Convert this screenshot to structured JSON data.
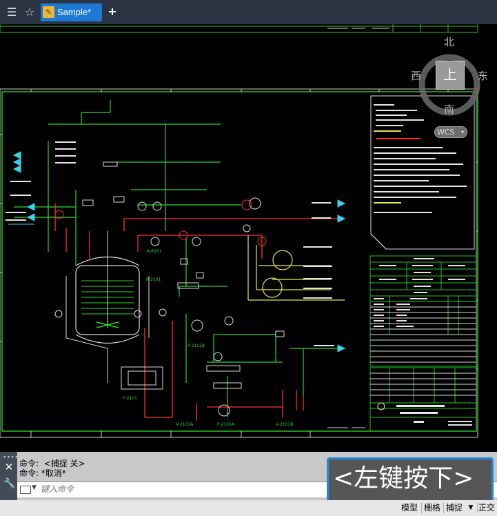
{
  "titlebar": {
    "document_tab": "Sample*",
    "icons": {
      "menu": "list-menu-icon",
      "favorite": "star-icon",
      "app": "drawing-file-icon",
      "new_tab": "plus-icon"
    }
  },
  "viewcube": {
    "north": "北",
    "south": "南",
    "east": "东",
    "west": "西",
    "top_face": "上",
    "wcs": "WCS"
  },
  "drawing": {
    "label_a_r201": "A-R201",
    "label_r_2101": "R-2101",
    "label_p_2101b": "P-2101B",
    "label_f_2101": "F-2101",
    "label_v_2101a": "V-2101A",
    "label_p_2101a": "P-2101A",
    "label_v_2101b": "V-2101B",
    "colors": {
      "border": "#22c422",
      "process": "#2dd52d",
      "steam": "#ff3030",
      "utility": "#e8e84a",
      "cyan": "#35d6ee",
      "white": "#ffffff"
    }
  },
  "command": {
    "history": [
      "命令:  <捕捉 关>",
      "命令: *取消*"
    ],
    "placeholder": "键入命令"
  },
  "key_overlay": {
    "text": "<左键按下>"
  },
  "statusbar": {
    "model": "模型",
    "grid": "栅格",
    "snap": "捕捉",
    "ortho": "正交"
  }
}
